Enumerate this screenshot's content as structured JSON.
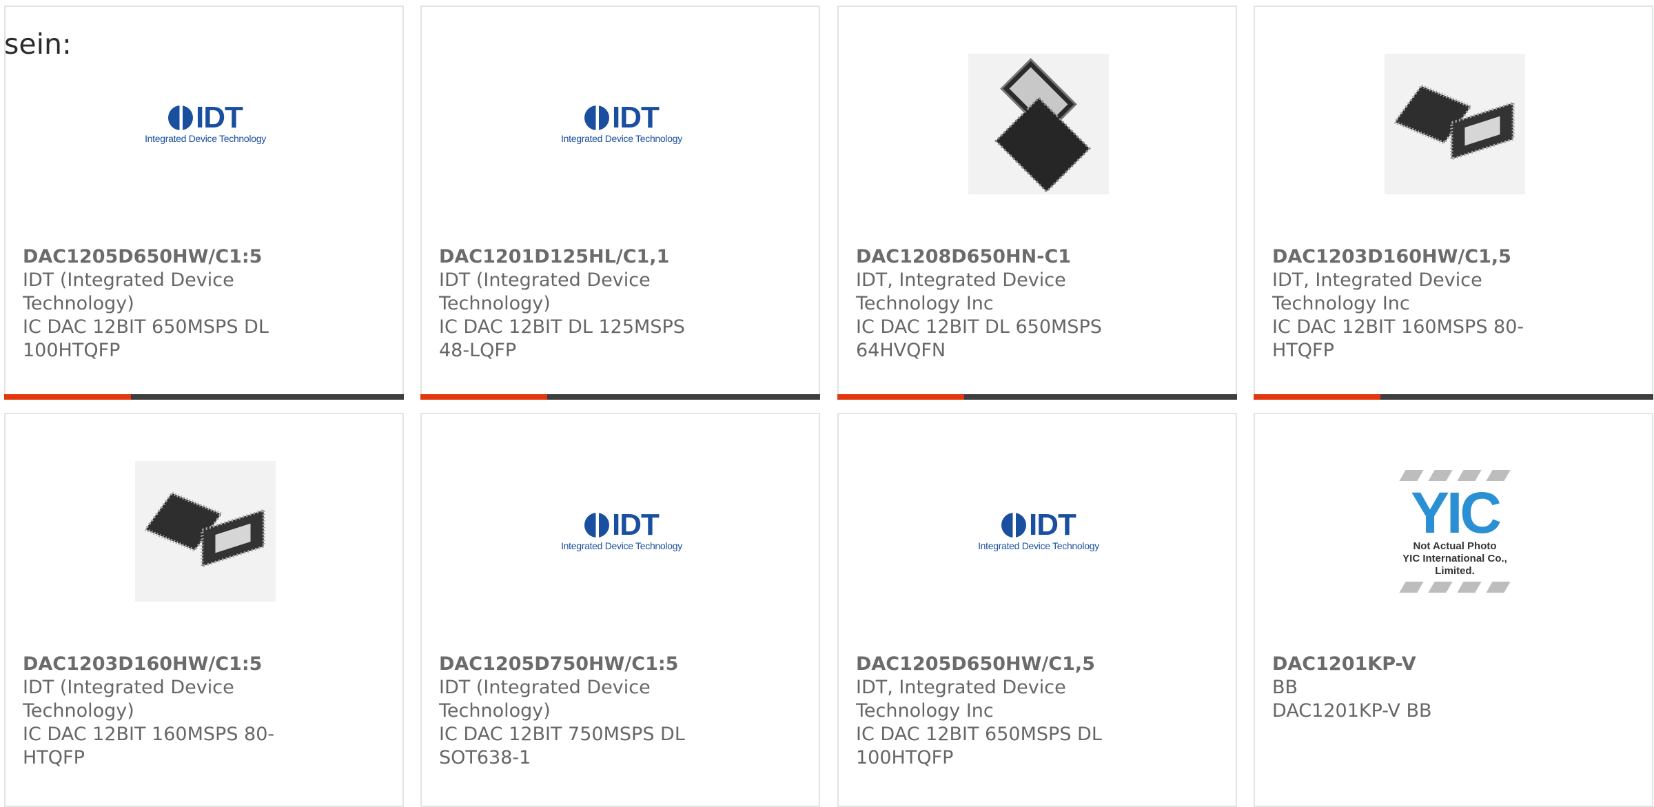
{
  "lead_text": "sein:",
  "products": [
    {
      "part": "DAC1205D650HW/C1:5",
      "maker": "IDT (Integrated Device Technology)",
      "desc": "IC DAC 12BIT 650MSPS DL 100HTQFP",
      "image": "idt-logo",
      "bar": true
    },
    {
      "part": "DAC1201D125HL/C1,1",
      "maker": "IDT (Integrated Device Technology)",
      "desc": "IC DAC 12BIT DL 125MSPS 48-LQFP",
      "image": "idt-logo",
      "bar": true
    },
    {
      "part": "DAC1208D650HN-C1",
      "maker": "IDT, Integrated Device Technology Inc",
      "desc": "IC DAC 12BIT DL 650MSPS 64HVQFN",
      "image": "qfn-chip-photo",
      "bar": true
    },
    {
      "part": "DAC1203D160HW/C1,5",
      "maker": "IDT, Integrated Device Technology Inc",
      "desc": "IC DAC 12BIT 160MSPS 80-HTQFP",
      "image": "qfp-chip-photo",
      "bar": true
    },
    {
      "part": "DAC1203D160HW/C1:5",
      "maker": "IDT (Integrated Device Technology)",
      "desc": "IC DAC 12BIT 160MSPS 80-HTQFP",
      "image": "qfp-chip-photo",
      "bar": false
    },
    {
      "part": "DAC1205D750HW/C1:5",
      "maker": "IDT (Integrated Device Technology)",
      "desc": "IC DAC 12BIT 750MSPS DL SOT638-1",
      "image": "idt-logo",
      "bar": false
    },
    {
      "part": "DAC1205D650HW/C1,5",
      "maker": "IDT, Integrated Device Technology Inc",
      "desc": "IC DAC 12BIT 650MSPS DL 100HTQFP",
      "image": "idt-logo",
      "bar": false
    },
    {
      "part": "DAC1201KP-V",
      "maker": "BB",
      "desc": "DAC1201KP-V BB",
      "image": "yic-placeholder",
      "bar": false
    }
  ],
  "idt_logo": {
    "word": "IDT",
    "tagline": "Integrated Device Technology"
  },
  "yic_placeholder": {
    "mark": "YIC",
    "line1": "Not Actual Photo",
    "line2": "YIC International Co., Limited."
  },
  "colors": {
    "accent": "#e2380f",
    "bar": "#3e3e3e",
    "border": "#e3e3e3",
    "text": "#666666",
    "idt_blue": "#1a4fa0",
    "yic_blue": "#2a8fd3"
  }
}
